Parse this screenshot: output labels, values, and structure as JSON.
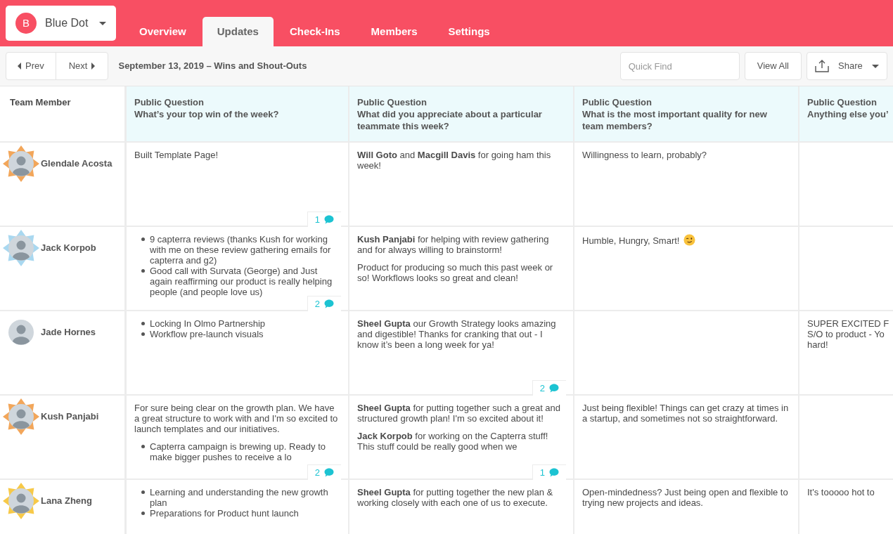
{
  "workspace": {
    "initial": "B",
    "name": "Blue Dot"
  },
  "tabs": [
    {
      "label": "Overview",
      "selected": false
    },
    {
      "label": "Updates",
      "selected": true
    },
    {
      "label": "Check-Ins",
      "selected": false
    },
    {
      "label": "Members",
      "selected": false
    },
    {
      "label": "Settings",
      "selected": false
    }
  ],
  "toolbar": {
    "prev": "Prev",
    "next": "Next",
    "title": "September 13, 2019 – Wins and Shout-Outs",
    "search": {
      "placeholder": "Quick Find"
    },
    "view_all": "View All",
    "share": "Share"
  },
  "table": {
    "first_column": "Team Member",
    "columns": [
      {
        "label": "Public Question",
        "question": "What’s your top win of the week?"
      },
      {
        "label": "Public Question",
        "question": "What did you appreciate about a particular teammate this week?"
      },
      {
        "label": "Public Question",
        "question": "What is the most important quality for new team members?"
      },
      {
        "label": "Public Question",
        "question": "Anything else you’"
      }
    ],
    "rows": [
      {
        "member": "Glendale Acosta",
        "color": "#f2a65a",
        "cells": [
          {
            "blocks": [
              {
                "kind": "para",
                "text": "Built Template Page!"
              }
            ],
            "comments": "1"
          },
          {
            "blocks": [
              {
                "kind": "para",
                "text": "**Will Goto** and **Macgill Davis** for going ham this week!"
              }
            ]
          },
          {
            "blocks": [
              {
                "kind": "para",
                "text": "Willingness to learn, probably?"
              }
            ]
          },
          null
        ]
      },
      {
        "member": "Jack Korpob",
        "color": "#a9d8f0",
        "cells": [
          {
            "blocks": [
              {
                "kind": "bullets",
                "items": [
                  "9 capterra reviews (thanks Kush for working with me on these review gathering emails for capterra and g2)",
                  "Good call with Survata (George) and Just again reaffirming our product is really helping people (and people love us)"
                ]
              }
            ],
            "comments": "2"
          },
          {
            "blocks": [
              {
                "kind": "para",
                "text": "**Kush Panjabi** for helping with review gathering and for always willing to brainstorm!"
              },
              {
                "kind": "para",
                "text": "Product for producing so much this past week or so! Workflows looks so great and clean!"
              }
            ]
          },
          {
            "blocks": [
              {
                "kind": "para_wink",
                "text": "Humble, Hungry, Smart!"
              }
            ]
          },
          null
        ]
      },
      {
        "member": "Jade Hornes",
        "cells": [
          {
            "blocks": [
              {
                "kind": "bullets",
                "items": [
                  "Locking In Olmo Partnership",
                  "Workflow pre-launch visuals"
                ]
              }
            ]
          },
          {
            "blocks": [
              {
                "kind": "para",
                "text": "**Sheel Gupta** our Growth Strategy looks amazing and digestible! Thanks for cranking that out - I know it’s been a long week for ya!"
              }
            ],
            "comments": "2"
          },
          null,
          {
            "blocks": [
              {
                "kind": "lines",
                "items": [
                  "SUPER EXCITED F",
                  "S/O to product - Yo",
                  "hard!"
                ]
              }
            ]
          }
        ]
      },
      {
        "member": "Kush Panjabi",
        "color": "#f2a65a",
        "cells": [
          {
            "blocks": [
              {
                "kind": "para",
                "text": "For sure being clear on the growth plan. We have a great structure to work with and I'm so excited to launch templates and our initiatives."
              },
              {
                "kind": "bullets",
                "items": [
                  "Capterra campaign is brewing up. Ready to make bigger pushes to receive a lo"
                ]
              }
            ],
            "comments": "2"
          },
          {
            "blocks": [
              {
                "kind": "para",
                "text": "**Sheel Gupta** for putting together such a great and structured growth plan! I'm so excited about it!"
              },
              {
                "kind": "para",
                "text": "**Jack Korpob** for working on the Capterra stuff! This stuff could be really good when we"
              }
            ],
            "comments": "1"
          },
          {
            "blocks": [
              {
                "kind": "para",
                "text": "Just being flexible! Things can get crazy at times in a startup, and sometimes not so straightforward."
              }
            ]
          },
          null
        ]
      },
      {
        "member": "Lana Zheng",
        "color": "#f7c948",
        "cells": [
          {
            "blocks": [
              {
                "kind": "bullets",
                "items": [
                  "Learning and understanding the new growth plan",
                  "Preparations for Product hunt launch"
                ]
              }
            ]
          },
          {
            "blocks": [
              {
                "kind": "para",
                "text": "**Sheel Gupta** for putting together the new plan & working closely with each one of us to execute."
              }
            ]
          },
          {
            "blocks": [
              {
                "kind": "para",
                "text": "Open-mindedness? Just being open and flexible to trying new projects and ideas."
              }
            ]
          },
          {
            "blocks": [
              {
                "kind": "lines",
                "items": [
                  "It's tooooo hot to"
                ]
              }
            ]
          }
        ]
      }
    ]
  }
}
